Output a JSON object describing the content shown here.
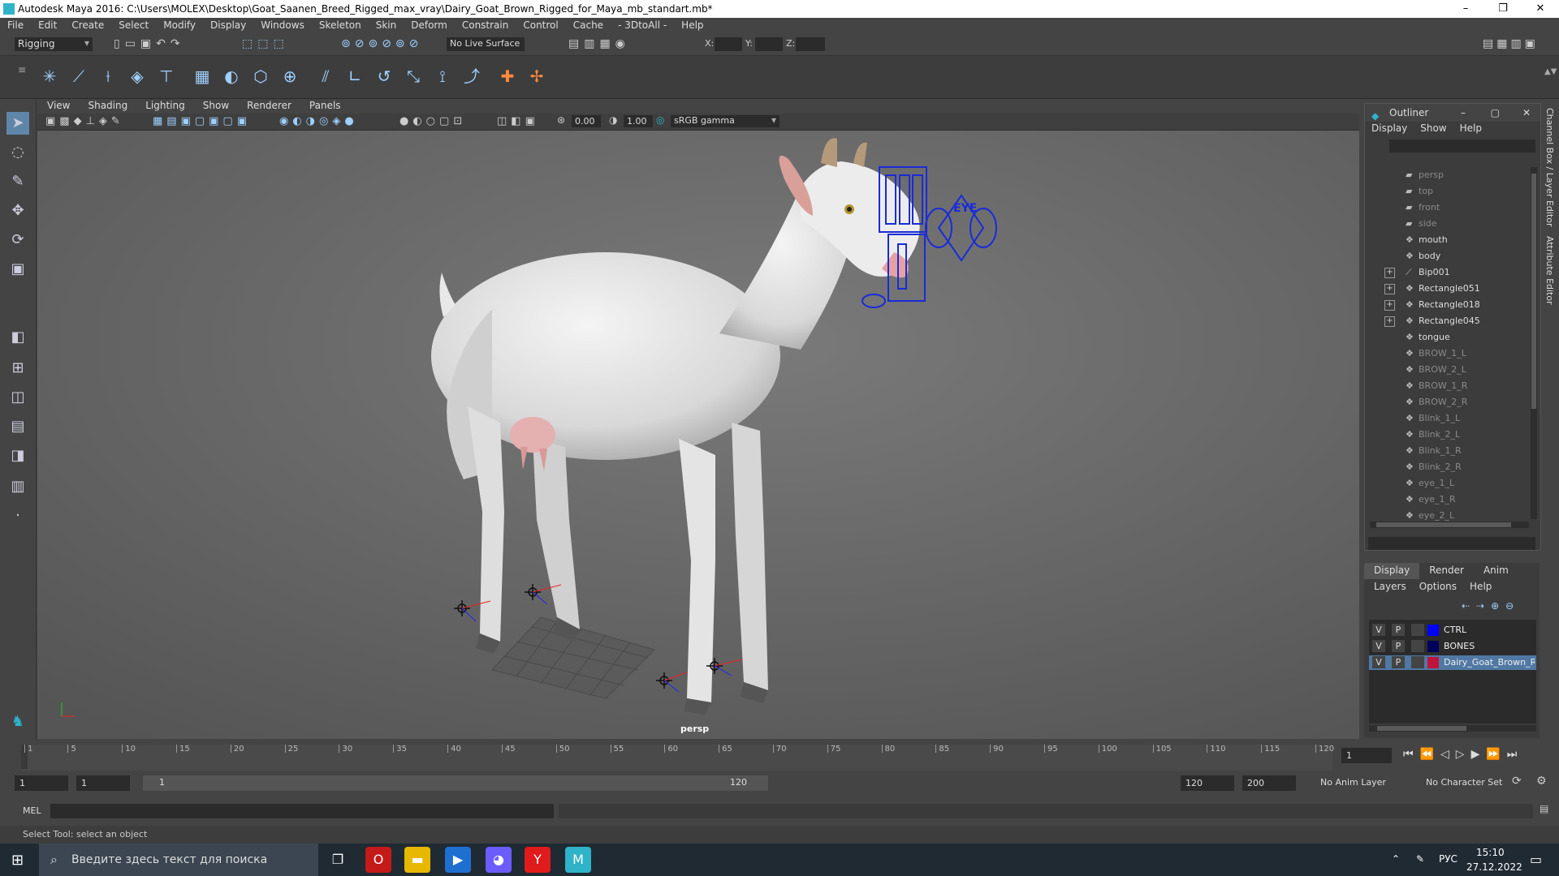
{
  "window": {
    "title": "Autodesk Maya 2016: C:\\Users\\MOLEX\\Desktop\\Goat_Saanen_Breed_Rigged_max_vray\\Dairy_Goat_Brown_Rigged_for_Maya_mb_standart.mb*",
    "minimize": "–",
    "maximize": "❐",
    "close": "✕"
  },
  "menubar": [
    "File",
    "Edit",
    "Create",
    "Select",
    "Modify",
    "Display",
    "Windows",
    "Skeleton",
    "Skin",
    "Deform",
    "Constrain",
    "Control",
    "Cache",
    "- 3DtoAll -",
    "Help"
  ],
  "statusline": {
    "mode": "Rigging",
    "live_surface": "No Live Surface",
    "x_label": "X:",
    "y_label": "Y:",
    "z_label": "Z:"
  },
  "panel": {
    "menu": [
      "View",
      "Shading",
      "Lighting",
      "Show",
      "Renderer",
      "Panels"
    ],
    "exposure": "0.00",
    "gamma": "1.00",
    "colorspace": "sRGB gamma",
    "camera_label": "persp",
    "eye_label": "EYE"
  },
  "outliner": {
    "title": "Outliner",
    "menu": [
      "Display",
      "Show",
      "Help"
    ],
    "items": [
      {
        "label": "persp",
        "dim": true,
        "icon": "camera",
        "expand": false
      },
      {
        "label": "top",
        "dim": true,
        "icon": "camera",
        "expand": false
      },
      {
        "label": "front",
        "dim": true,
        "icon": "camera",
        "expand": false
      },
      {
        "label": "side",
        "dim": true,
        "icon": "camera",
        "expand": false
      },
      {
        "label": "mouth",
        "dim": false,
        "icon": "mesh",
        "expand": false
      },
      {
        "label": "body",
        "dim": false,
        "icon": "mesh",
        "expand": false
      },
      {
        "label": "Bip001",
        "dim": false,
        "icon": "joint",
        "expand": true
      },
      {
        "label": "Rectangle051",
        "dim": false,
        "icon": "mesh",
        "expand": true
      },
      {
        "label": "Rectangle018",
        "dim": false,
        "icon": "mesh",
        "expand": true
      },
      {
        "label": "Rectangle045",
        "dim": false,
        "icon": "mesh",
        "expand": true
      },
      {
        "label": "tongue",
        "dim": false,
        "icon": "mesh",
        "expand": false
      },
      {
        "label": "BROW_1_L",
        "dim": true,
        "icon": "mesh",
        "expand": false
      },
      {
        "label": "BROW_2_L",
        "dim": true,
        "icon": "mesh",
        "expand": false
      },
      {
        "label": "BROW_1_R",
        "dim": true,
        "icon": "mesh",
        "expand": false
      },
      {
        "label": "BROW_2_R",
        "dim": true,
        "icon": "mesh",
        "expand": false
      },
      {
        "label": "Blink_1_L",
        "dim": true,
        "icon": "mesh",
        "expand": false
      },
      {
        "label": "Blink_2_L",
        "dim": true,
        "icon": "mesh",
        "expand": false
      },
      {
        "label": "Blink_1_R",
        "dim": true,
        "icon": "mesh",
        "expand": false
      },
      {
        "label": "Blink_2_R",
        "dim": true,
        "icon": "mesh",
        "expand": false
      },
      {
        "label": "eye_1_L",
        "dim": true,
        "icon": "mesh",
        "expand": false
      },
      {
        "label": "eye_1_R",
        "dim": true,
        "icon": "mesh",
        "expand": false
      },
      {
        "label": "eye_2_L",
        "dim": true,
        "icon": "mesh",
        "expand": false
      }
    ]
  },
  "vertical_tabs": [
    "Channel Box / Layer Editor",
    "Attribute Editor"
  ],
  "layer_editor": {
    "tabs": [
      "Display",
      "Render",
      "Anim"
    ],
    "menu": [
      "Layers",
      "Options",
      "Help"
    ],
    "layers": [
      {
        "v": "V",
        "p": "P",
        "color": "#0000ff",
        "name": "CTRL",
        "selected": false
      },
      {
        "v": "V",
        "p": "P",
        "color": "#00005a",
        "name": "BONES",
        "selected": false
      },
      {
        "v": "V",
        "p": "P",
        "color": "#c0143c",
        "name": "Dairy_Goat_Brown_Rigged",
        "selected": true
      }
    ]
  },
  "timeline": {
    "ticks": [
      1,
      5,
      10,
      15,
      20,
      25,
      30,
      35,
      40,
      45,
      50,
      55,
      60,
      65,
      70,
      75,
      80,
      85,
      90,
      95,
      100,
      105,
      110,
      115,
      120
    ],
    "current_frame": "1"
  },
  "range": {
    "start": "1",
    "playback_start": "1",
    "slider_start": "1",
    "slider_end": "120",
    "playback_end": "120",
    "end": "200",
    "anim_layer": "No Anim Layer",
    "character_set": "No Character Set"
  },
  "command_line": {
    "label": "MEL"
  },
  "help_line": {
    "text": "Select Tool: select an object"
  },
  "taskbar": {
    "search_placeholder": "Введите здесь текст для поиска",
    "lang": "РУС",
    "time": "15:10",
    "date": "27.12.2022"
  }
}
